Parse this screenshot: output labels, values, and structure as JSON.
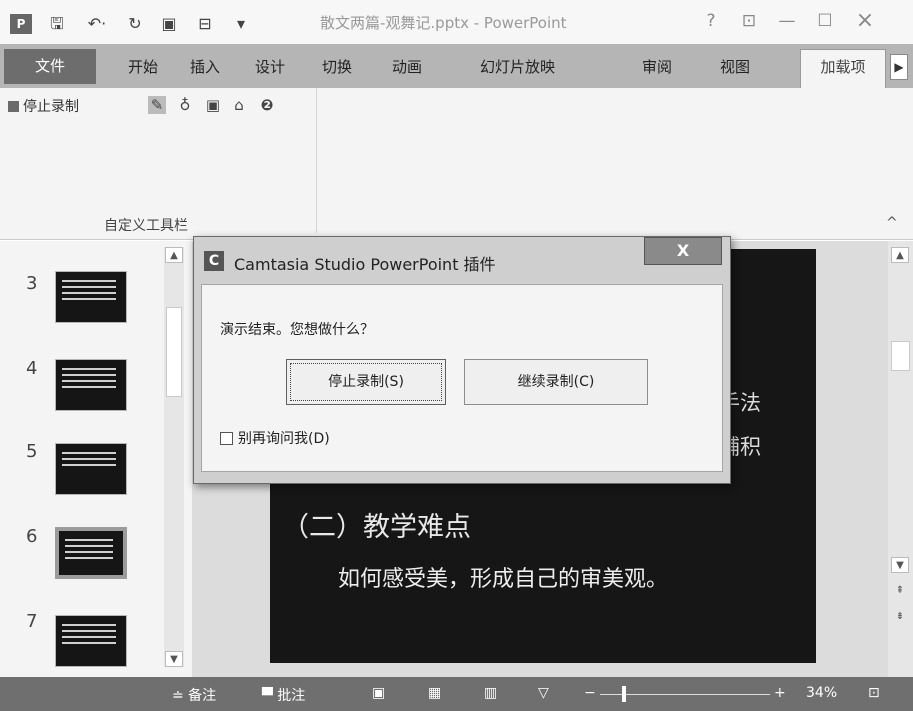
{
  "window": {
    "title": "散文两篇-观舞记.pptx - PowerPoint",
    "help": "?",
    "ribbon_display": "⊡",
    "minimize": "—",
    "maximize": "☐",
    "close": "×"
  },
  "quick_access": {
    "app_icon": "P",
    "save": "🖫",
    "undo": "↶·",
    "redo": "↻",
    "start_from_beginning": "▣",
    "customize": "▾"
  },
  "tabs": {
    "file": "文件",
    "items": [
      "开始",
      "插入",
      "设计",
      "切换",
      "动画",
      "幻灯片放映",
      "审阅",
      "视图"
    ],
    "active": "加载项",
    "more": "▶"
  },
  "ribbon": {
    "stop_recording": "停止录制",
    "group_label": "自定义工具栏",
    "collapse": "^"
  },
  "slide_pane": {
    "numbers": [
      "3",
      "4",
      "5",
      "6",
      "7"
    ]
  },
  "slide": {
    "fragment1": "手法",
    "fragment2": "铺积",
    "heading": "（二）教学难点",
    "body": "如何感受美，形成自己的审美观。"
  },
  "dialog": {
    "title": "Camtasia Studio PowerPoint 插件",
    "close": "X",
    "message": "演示结束。您想做什么？",
    "stop_button": "停止录制(S)",
    "continue_button": "继续录制(C)",
    "checkbox_label": "别再询问我(D)"
  },
  "status": {
    "notes": "≐ 备注",
    "comments": "▀ 批注",
    "zoom_minus": "−",
    "zoom_plus": "+",
    "zoom": "34%",
    "fit": "⊡",
    "zoom_level": 0.14
  }
}
